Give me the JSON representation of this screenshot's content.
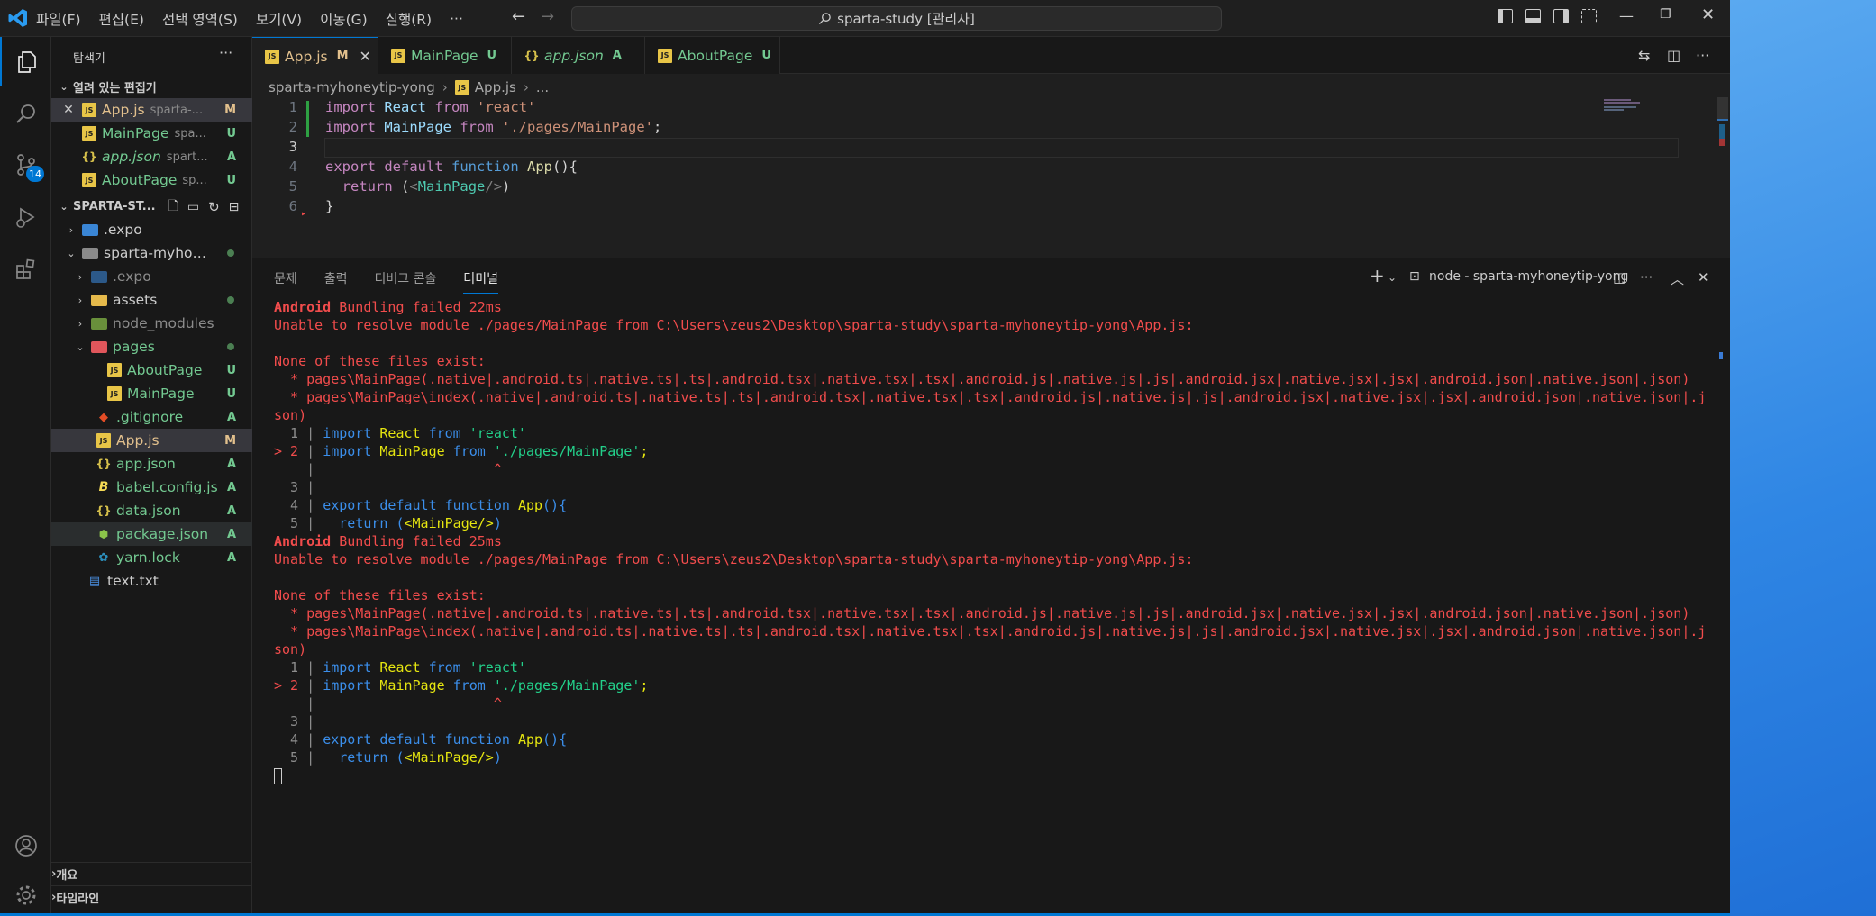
{
  "menu": [
    "파일(F)",
    "편집(E)",
    "선택 영역(S)",
    "보기(V)",
    "이동(G)",
    "실행(R)",
    "···"
  ],
  "search": {
    "text": "sparta-study [관리자]"
  },
  "sidebar": {
    "title": "탐색기",
    "more": "···",
    "open_editors": {
      "title": "열려 있는 편집기",
      "items": [
        {
          "name": "App.js",
          "path": "sparta-...",
          "status": "M"
        },
        {
          "name": "MainPage",
          "path": "spa...",
          "status": "U"
        },
        {
          "name": "app.json",
          "path": "spart...",
          "status": "A"
        },
        {
          "name": "AboutPage",
          "path": "sp...",
          "status": "U"
        }
      ]
    },
    "project": {
      "title": "SPARTA-ST...",
      "tree": [
        {
          "name": ".expo"
        },
        {
          "name": "sparta-myhon..."
        },
        {
          "name": ".expo"
        },
        {
          "name": "assets"
        },
        {
          "name": "node_modules"
        },
        {
          "name": "pages"
        },
        {
          "name": "AboutPage",
          "status": "U"
        },
        {
          "name": "MainPage",
          "status": "U"
        },
        {
          "name": ".gitignore",
          "status": "A"
        },
        {
          "name": "App.js",
          "status": "M"
        },
        {
          "name": "app.json",
          "status": "A"
        },
        {
          "name": "babel.config.js",
          "status": "A"
        },
        {
          "name": "data.json",
          "status": "A"
        },
        {
          "name": "package.json",
          "status": "A"
        },
        {
          "name": "yarn.lock",
          "status": "A"
        },
        {
          "name": "text.txt"
        }
      ]
    },
    "outline": "개요",
    "timeline": "타임라인"
  },
  "activity": {
    "source_control_badge": "14"
  },
  "tabs": [
    {
      "name": "App.js",
      "status": "M"
    },
    {
      "name": "MainPage",
      "status": "U"
    },
    {
      "name": "app.json",
      "status": "A"
    },
    {
      "name": "AboutPage",
      "status": "U"
    }
  ],
  "breadcrumb": {
    "folder": "sparta-myhoneytip-yong",
    "file": "App.js",
    "more": "..."
  },
  "editor": {
    "line_numbers": [
      "1",
      "2",
      "3",
      "4",
      "5",
      "6"
    ],
    "l1": {
      "import": "import",
      "react": "React",
      "from": "from",
      "str": "'react'"
    },
    "l2": {
      "import": "import",
      "name": "MainPage",
      "from": "from",
      "str": "'./pages/MainPage'",
      "end": ";"
    },
    "l4": {
      "export": "export",
      "default": "default",
      "function": "function",
      "name": "App",
      "rest": "(){"
    },
    "l5": {
      "return": "return",
      "open": "(",
      "tag_open": "<",
      "tag": "MainPage",
      "tag_close": "/>",
      "close": ")"
    },
    "l6": {
      "brace": "}"
    }
  },
  "panel": {
    "tabs": [
      "문제",
      "출력",
      "디버그 콘솔",
      "터미널"
    ],
    "terminal_name": "node - sparta-myhoneytip-yong",
    "terminal": {
      "android": "Android",
      "fail1": " Bundling failed 22ms",
      "fail2": " Bundling failed 25ms",
      "unable": "Unable to resolve module ./pages/MainPage from C:\\Users\\zeus2\\Desktop\\sparta-study\\sparta-myhoneytip-yong\\App.js:",
      "none": "None of these files exist:",
      "exist1": "  * pages\\MainPage(.native|.android.ts|.native.ts|.ts|.android.tsx|.native.tsx|.tsx|.android.js|.native.js|.js|.android.jsx|.native.jsx|.jsx|.android.json|.native.json|.json)",
      "exist2a": "  * pages\\MainPage\\index(.native|.android.ts|.native.ts|.ts|.android.tsx|.native.tsx|.tsx|.android.js|.native.js|.js|.android.jsx|.native.jsx|.jsx|.android.json|.native.json|.j",
      "exist2b": "son)",
      "c1_num": "  1 ",
      "c2_num": "> 2 ",
      "c3_num": "  3 ",
      "c4_num": "  4 ",
      "c5_num": "  5 ",
      "pipe": "| ",
      "c1_import": "import ",
      "c1_react": "React",
      "c1_from": " from ",
      "c1_str": "'react'",
      "c2_name": "MainPage",
      "c2_str": "'./pages/MainPage'",
      "c2_end": ";",
      "caret": "                     ^",
      "c4_export": "export default function ",
      "c4_fn": "App",
      "c4_rest": "(){",
      "c5_return": "  return ",
      "c5_open": "(",
      "c5_tag": "<MainPage/>",
      "c5_close": ")"
    }
  }
}
